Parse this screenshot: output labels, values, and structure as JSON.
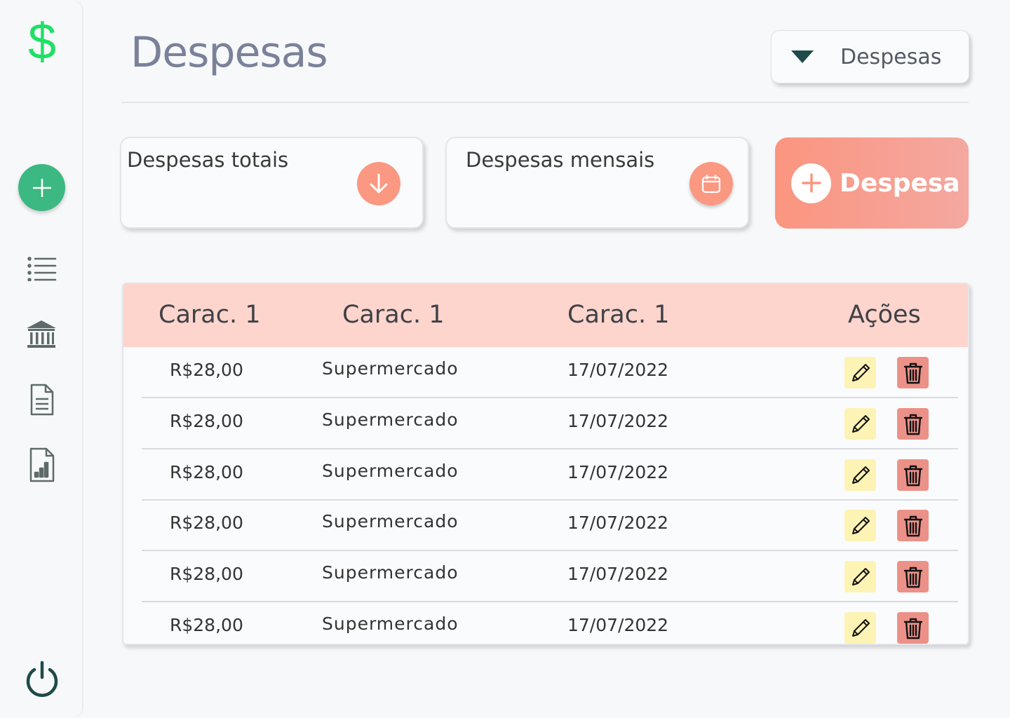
{
  "sidebar": {
    "logo_symbol": "$",
    "icons": [
      "dollar-logo",
      "add-icon",
      "list-icon",
      "bank-icon",
      "document-icon",
      "report-icon",
      "power-icon"
    ],
    "logo_color": "#1fe066",
    "add_color": "#3cb882"
  },
  "header": {
    "title": "Despesas",
    "dropdown_value": "Despesas"
  },
  "cards": {
    "total": {
      "title": "Despesas totais",
      "icon": "arrow-down-icon"
    },
    "monthly": {
      "title": "Despesas mensais",
      "icon": "calendar-icon"
    }
  },
  "add_button": {
    "label": "Despesa",
    "icon": "plus-icon"
  },
  "table": {
    "headers": [
      "Carac. 1",
      "Carac. 1",
      "Carac. 1",
      "Ações"
    ],
    "rows": [
      {
        "amount": "R$28,00",
        "category": "Supermercado",
        "date": "17/07/2022"
      },
      {
        "amount": "R$28,00",
        "category": "Supermercado",
        "date": "17/07/2022"
      },
      {
        "amount": "R$28,00",
        "category": "Supermercado",
        "date": "17/07/2022"
      },
      {
        "amount": "R$28,00",
        "category": "Supermercado",
        "date": "17/07/2022"
      },
      {
        "amount": "R$28,00",
        "category": "Supermercado",
        "date": "17/07/2022"
      },
      {
        "amount": "R$28,00",
        "category": "Supermercado",
        "date": "17/07/2022"
      }
    ],
    "header_color": "#fdd5cc",
    "edit_color": "#fdf3b4",
    "delete_color": "#ec9188"
  },
  "accent": "#fb9882"
}
